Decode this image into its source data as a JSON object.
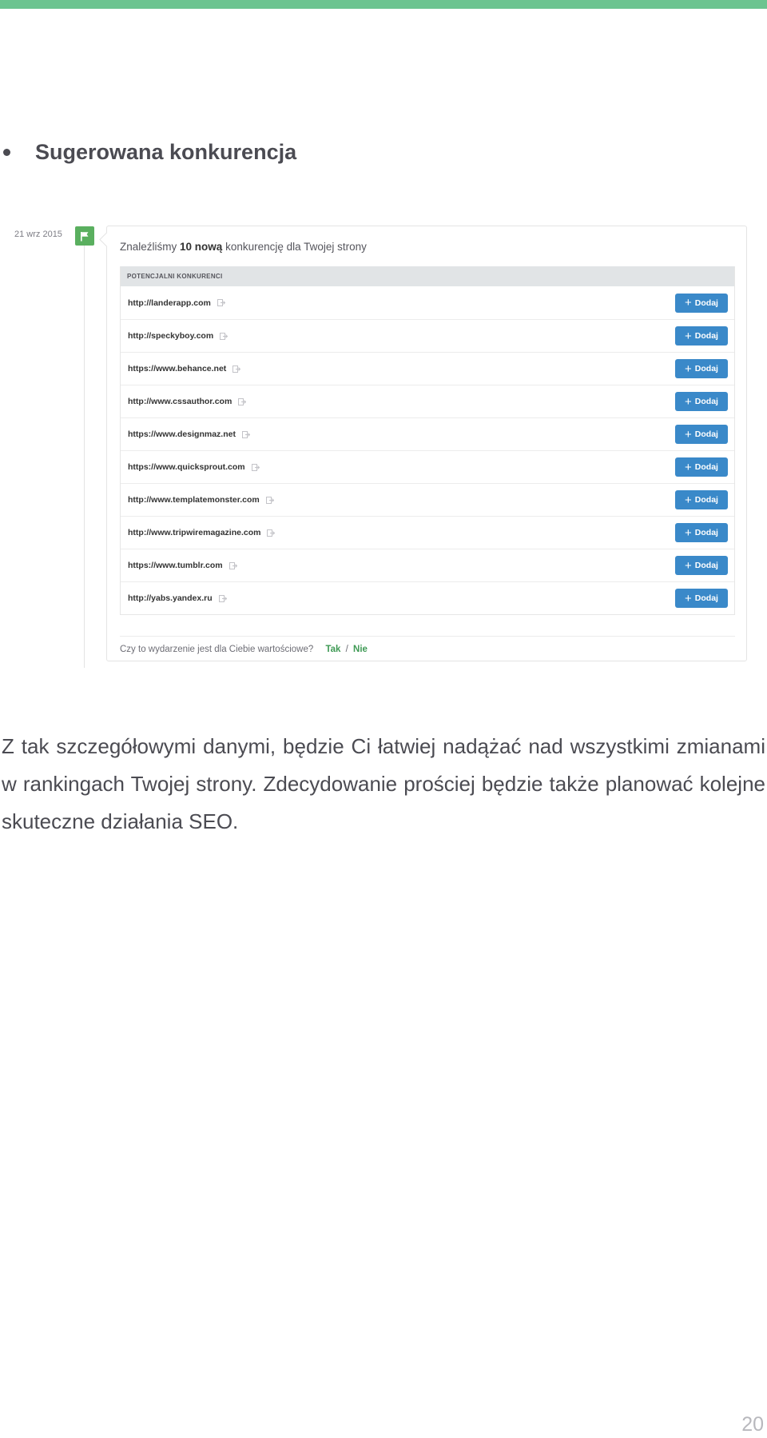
{
  "section": {
    "title": "Sugerowana konkurencja"
  },
  "event": {
    "date": "21 wrz 2015",
    "heading_prefix": "Znaleźliśmy",
    "heading_bold": "10 nową",
    "heading_suffix": "konkurencję dla Twojej strony",
    "table_header": "POTENCJALNI KONKURENCI",
    "add_label": "Dodaj",
    "competitors": [
      "http://landerapp.com",
      "http://speckyboy.com",
      "https://www.behance.net",
      "http://www.cssauthor.com",
      "https://www.designmaz.net",
      "https://www.quicksprout.com",
      "http://www.templatemonster.com",
      "http://www.tripwiremagazine.com",
      "https://www.tumblr.com",
      "http://yabs.yandex.ru"
    ],
    "feedback_question": "Czy to wydarzenie jest dla Ciebie wartościowe?",
    "feedback_yes": "Tak",
    "feedback_separator": "/",
    "feedback_no": "Nie"
  },
  "body_text": "Z tak szczegółowymi danymi, będzie Ci łatwiej nadążać nad wszystkimi zmianami w rankingach Twojej strony. Zdecydowanie prościej będzie także planować kolejne skuteczne działania SEO.",
  "page_number": "20",
  "colors": {
    "accent_bar": "#6cc490",
    "flag": "#5aaf5f",
    "button": "#3a89c9",
    "link": "#3f9a55"
  }
}
